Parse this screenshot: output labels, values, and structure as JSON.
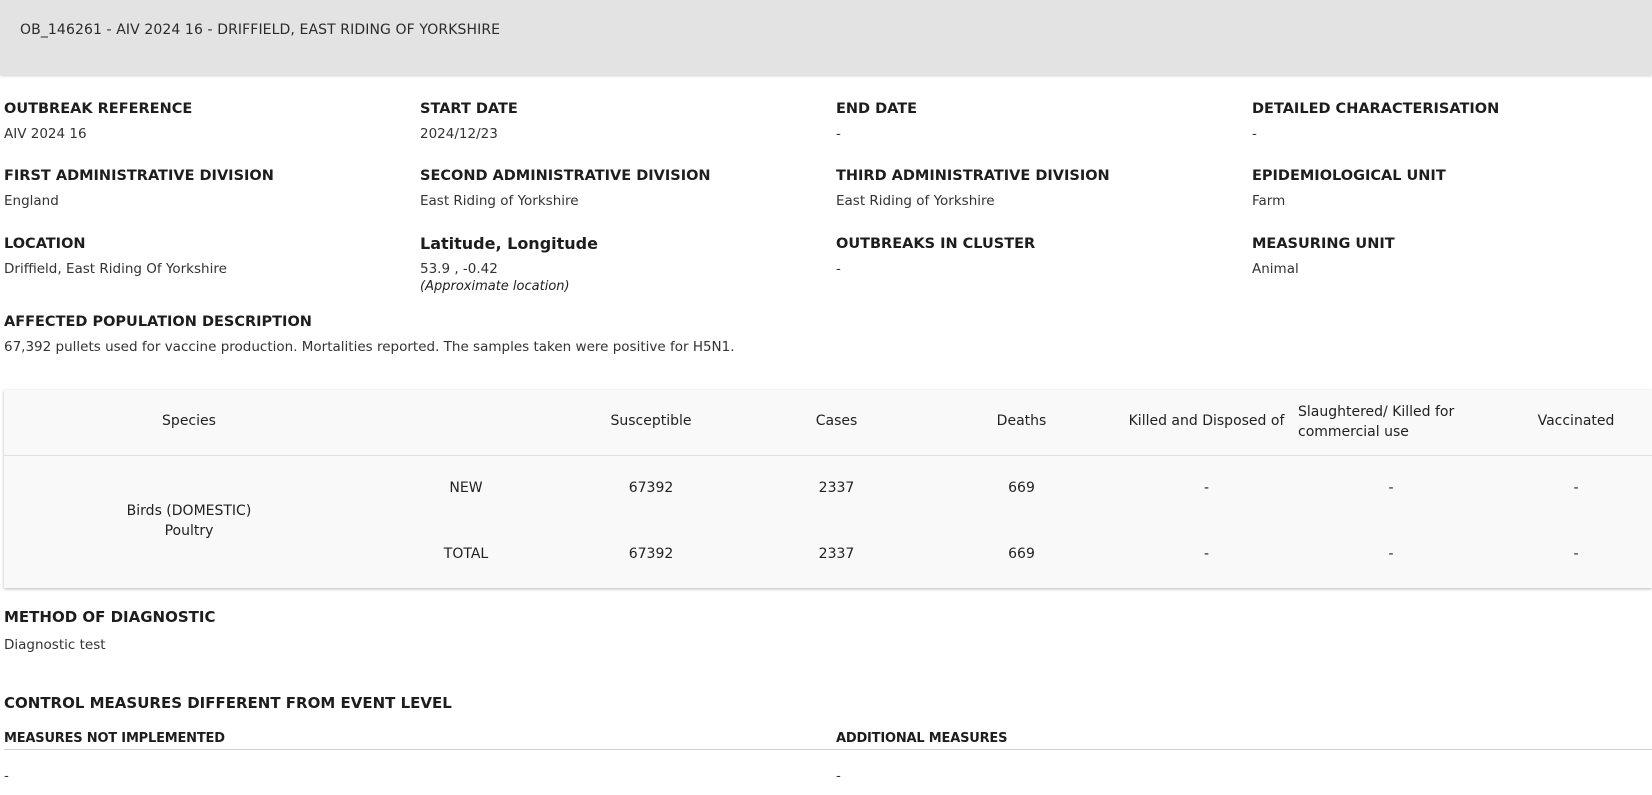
{
  "header": {
    "title": "OB_146261 - AIV 2024 16 - DRIFFIELD, EAST RIDING OF YORKSHIRE"
  },
  "fields": {
    "outbreak_reference": {
      "label": "OUTBREAK REFERENCE",
      "value": "AIV 2024 16"
    },
    "start_date": {
      "label": "START DATE",
      "value": "2024/12/23"
    },
    "end_date": {
      "label": "END DATE",
      "value": "-"
    },
    "detailed_characterisation": {
      "label": "DETAILED CHARACTERISATION",
      "value": "-"
    },
    "first_admin_division": {
      "label": "FIRST ADMINISTRATIVE DIVISION",
      "value": "England"
    },
    "second_admin_division": {
      "label": "SECOND ADMINISTRATIVE DIVISION",
      "value": "East Riding of Yorkshire"
    },
    "third_admin_division": {
      "label": "THIRD ADMINISTRATIVE DIVISION",
      "value": "East Riding of Yorkshire"
    },
    "epidemiological_unit": {
      "label": "EPIDEMIOLOGICAL UNIT",
      "value": "Farm"
    },
    "location": {
      "label": "LOCATION",
      "value": "Driffield, East Riding Of Yorkshire"
    },
    "lat_long": {
      "label": "Latitude, Longitude",
      "value": "53.9 , -0.42",
      "note": "(Approximate location)"
    },
    "outbreaks_in_cluster": {
      "label": "OUTBREAKS IN CLUSTER",
      "value": "-"
    },
    "measuring_unit": {
      "label": "MEASURING UNIT",
      "value": "Animal"
    }
  },
  "affected_population": {
    "label": "AFFECTED POPULATION DESCRIPTION",
    "value": "67,392 pullets used for vaccine production. Mortalities reported. The samples taken were positive for H5N1."
  },
  "table": {
    "headers": {
      "species": "Species",
      "susceptible": "Susceptible",
      "cases": "Cases",
      "deaths": "Deaths",
      "killed_disposed": "Killed and Disposed of",
      "slaughtered": "Slaughtered/ Killed for commercial use",
      "vaccinated": "Vaccinated"
    },
    "species_line1": "Birds (DOMESTIC)",
    "species_line2": "Poultry",
    "rows": [
      {
        "type": "NEW",
        "susceptible": "67392",
        "cases": "2337",
        "deaths": "669",
        "killed_disposed": "-",
        "slaughtered": "-",
        "vaccinated": "-"
      },
      {
        "type": "TOTAL",
        "susceptible": "67392",
        "cases": "2337",
        "deaths": "669",
        "killed_disposed": "-",
        "slaughtered": "-",
        "vaccinated": "-"
      }
    ]
  },
  "diagnostic": {
    "label": "METHOD OF DIAGNOSTIC",
    "value": "Diagnostic test"
  },
  "control_measures": {
    "title": "CONTROL MEASURES DIFFERENT FROM EVENT LEVEL",
    "not_implemented_label": "MEASURES NOT IMPLEMENTED",
    "not_implemented_value": "-",
    "additional_label": "ADDITIONAL MEASURES",
    "additional_value": "-"
  }
}
